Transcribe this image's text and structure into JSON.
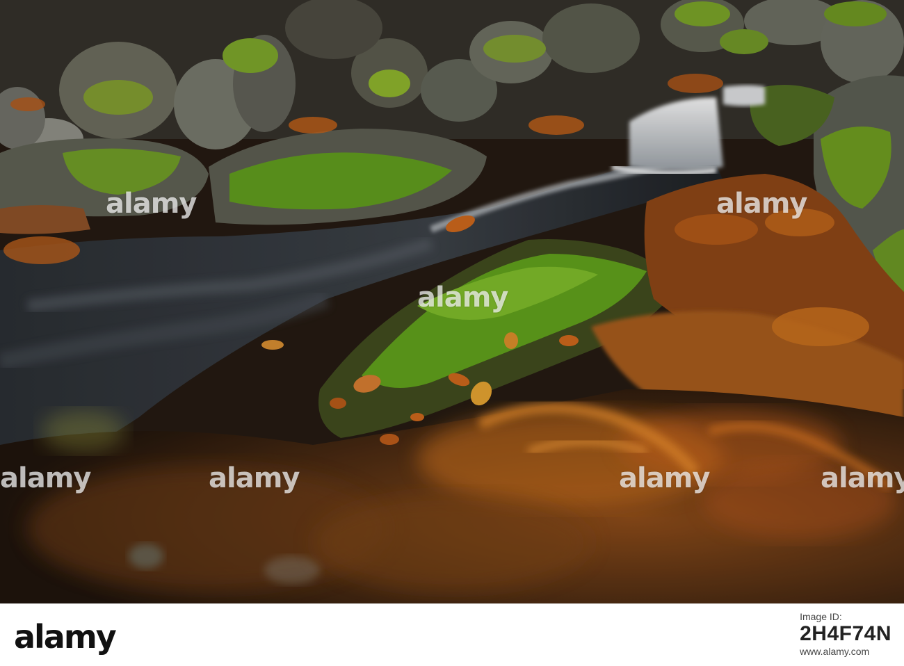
{
  "watermark": {
    "text": "alamy"
  },
  "footer": {
    "logo": "alamy",
    "image_id_label": "Image ID:",
    "image_id": "2H4F74N",
    "site": "www.alamy.com"
  },
  "colors": {
    "moss": "#6a9a24",
    "leaf": "#c46a1c",
    "water": "#1f2226",
    "rock": "#5c5a52"
  }
}
